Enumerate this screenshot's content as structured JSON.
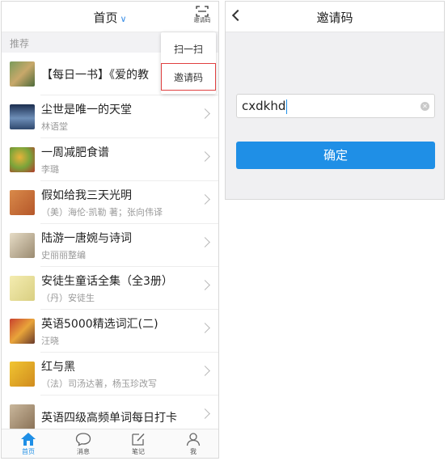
{
  "left": {
    "header": {
      "title": "首页",
      "scan_label": "邀请码"
    },
    "section_label": "推荐",
    "popup": {
      "items": [
        "扫一扫",
        "邀请码"
      ]
    },
    "books": [
      {
        "title": "【每日一书】《爱的教",
        "author": ""
      },
      {
        "title": "尘世是唯一的天堂",
        "author": "林语堂"
      },
      {
        "title": "一周减肥食谱",
        "author": "李璐"
      },
      {
        "title": "假如给我三天光明",
        "author": "（美）海伦·凯勒 著；张向伟译"
      },
      {
        "title": "陆游一唐婉与诗词",
        "author": "史丽丽整编"
      },
      {
        "title": "安徒生童话全集（全3册）",
        "author": "（丹）安徒生"
      },
      {
        "title": "英语5000精选词汇(二)",
        "author": "汪晓"
      },
      {
        "title": "红与黑",
        "author": "（法）司汤达著，杨玉珍改写"
      },
      {
        "title": "英语四级高频单词每日打卡",
        "author": ""
      }
    ],
    "tabs": [
      {
        "label": "首页",
        "icon": "home-icon"
      },
      {
        "label": "消息",
        "icon": "message-icon"
      },
      {
        "label": "笔记",
        "icon": "note-icon"
      },
      {
        "label": "我",
        "icon": "person-icon"
      }
    ]
  },
  "right": {
    "header": {
      "title": "邀请码"
    },
    "input": {
      "value": "cxdkhd"
    },
    "confirm_label": "确定"
  },
  "colors": {
    "accent": "#1f8fe6",
    "highlight_border": "#e04040"
  }
}
